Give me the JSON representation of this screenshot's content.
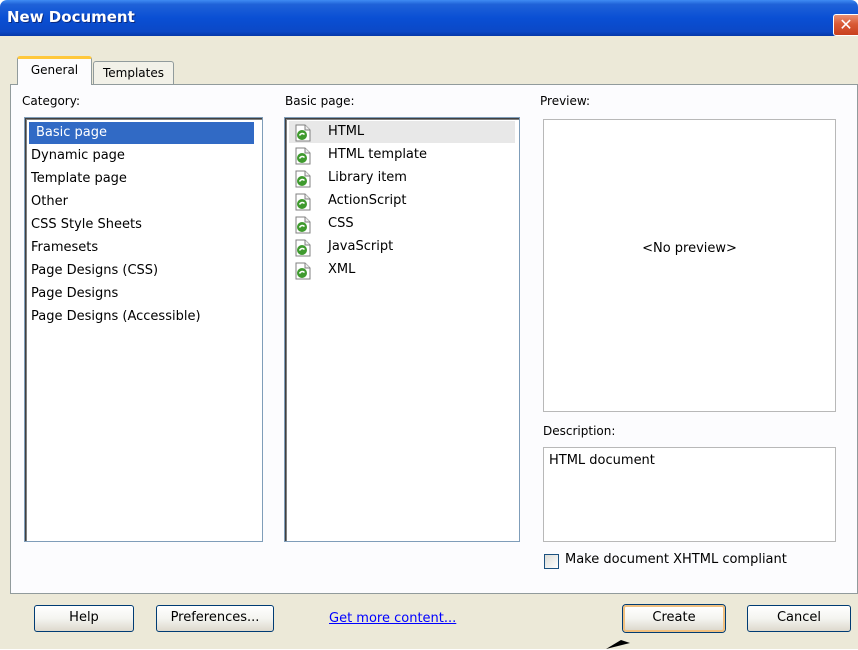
{
  "window": {
    "title": "New Document",
    "close_symbol": "✕"
  },
  "tabs": [
    {
      "label": "General",
      "active": true
    },
    {
      "label": "Templates",
      "active": false
    }
  ],
  "category": {
    "label": "Category:",
    "items": [
      {
        "label": "Basic page",
        "selected": true
      },
      {
        "label": "Dynamic page"
      },
      {
        "label": "Template page"
      },
      {
        "label": "Other"
      },
      {
        "label": "CSS Style Sheets"
      },
      {
        "label": "Framesets"
      },
      {
        "label": "Page Designs (CSS)"
      },
      {
        "label": "Page Designs"
      },
      {
        "label": "Page Designs (Accessible)"
      }
    ]
  },
  "basic_page": {
    "label": "Basic page:",
    "items": [
      {
        "label": "HTML",
        "icon": "document-icon",
        "selected": true
      },
      {
        "label": "HTML template",
        "icon": "document-icon"
      },
      {
        "label": "Library item",
        "icon": "document-icon"
      },
      {
        "label": "ActionScript",
        "icon": "document-icon"
      },
      {
        "label": "CSS",
        "icon": "document-icon"
      },
      {
        "label": "JavaScript",
        "icon": "document-icon"
      },
      {
        "label": "XML",
        "icon": "document-icon"
      }
    ]
  },
  "preview": {
    "label": "Preview:",
    "placeholder": "<No preview>"
  },
  "description": {
    "label": "Description:",
    "text": "HTML document"
  },
  "xhtml_checkbox": {
    "label": "Make document XHTML compliant",
    "checked": false
  },
  "buttons": {
    "help": "Help",
    "preferences": "Preferences...",
    "get_more_content": "Get more content...",
    "create": "Create",
    "cancel": "Cancel"
  },
  "colors": {
    "titlebar": "#0a4fd4",
    "selection": "#316ac5",
    "dialog_bg": "#ece9d8",
    "link": "#0000ff",
    "close_button": "#d95a35"
  }
}
